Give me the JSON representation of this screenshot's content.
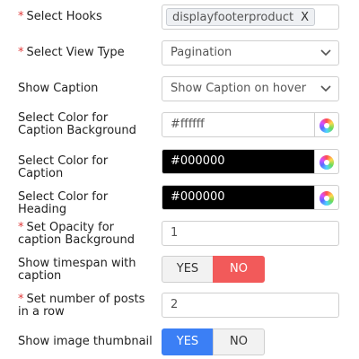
{
  "form": {
    "hooks": {
      "label": "Select Hooks",
      "required": true,
      "tag": "displayfooterproduct",
      "remove": "X"
    },
    "view_type": {
      "label": "Select View Type",
      "required": true,
      "value": "Pagination"
    },
    "caption": {
      "label": "Show Caption",
      "required": false,
      "value": "Show Caption on hover"
    },
    "caption_bg": {
      "label": "Select Color for Caption Background",
      "value": "#ffffff",
      "swatch": "#ffffff",
      "text_color": "#555555"
    },
    "caption_color": {
      "label": "Select Color for Caption",
      "value": "#000000",
      "swatch": "#000000",
      "text_color": "#ffffff"
    },
    "heading_color": {
      "label": "Select Color for Heading",
      "value": "#000000",
      "swatch": "#000000",
      "text_color": "#ffffff"
    },
    "opacity": {
      "label": "Set Opacity for caption Background",
      "required": true,
      "value": "1"
    },
    "timespan": {
      "label": "Show timespan with caption",
      "yes": "YES",
      "no": "NO",
      "selected": "NO"
    },
    "posts_per_row": {
      "label": "Set number of posts in a row",
      "required": true,
      "value": "2"
    },
    "thumbnail": {
      "label": "Show image thumbnail",
      "yes": "YES",
      "no": "NO",
      "selected": "YES"
    }
  },
  "required_mark": "*",
  "colors": {
    "required": "#e03a3a",
    "toggle_no_active": "#f25a5a",
    "toggle_yes_active": "#3b7ff5"
  }
}
